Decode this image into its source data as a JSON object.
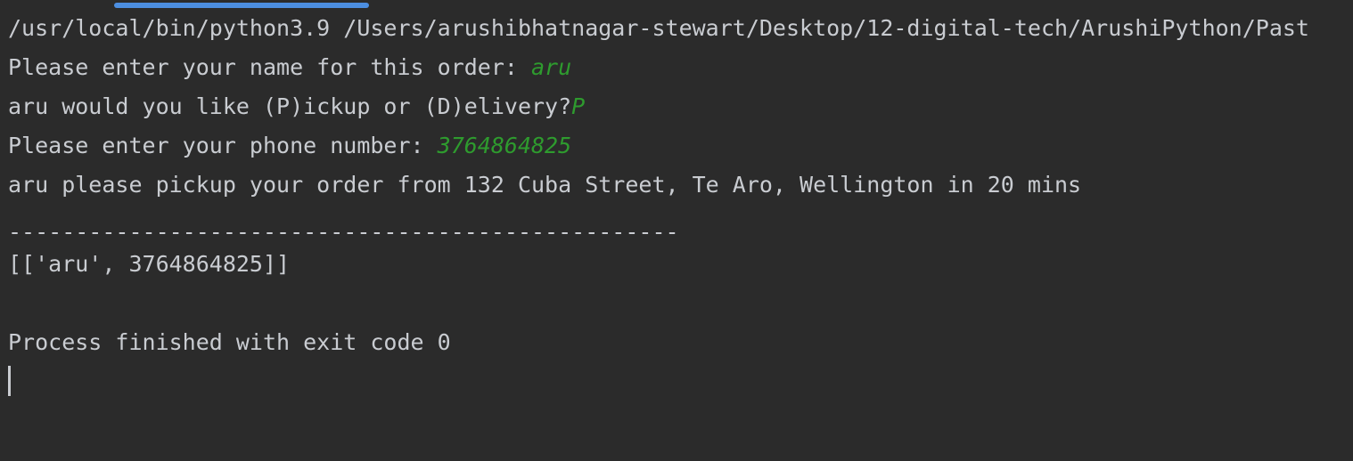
{
  "console": {
    "command": "/usr/local/bin/python3.9 /Users/arushibhatnagar-stewart/Desktop/12-digital-tech/ArushiPython/Past",
    "name_prompt": "Please enter your name for this order: ",
    "name_input": "aru",
    "method_prompt": "aru would you like (P)ickup or (D)elivery?",
    "method_input": "P",
    "phone_prompt": "Please enter your phone number: ",
    "phone_input": "3764864825",
    "pickup_message": "aru please pickup your order from 132 Cuba Street, Te Aro, Wellington in 20 mins",
    "separator": "--------------------------------------------------",
    "list_output": "[['aru', 3764864825]]",
    "exit_message": "Process finished with exit code 0"
  },
  "colors": {
    "background": "#2b2b2b",
    "text": "#c9ccd1",
    "user_input": "#2e9b2e",
    "scroll_thumb": "#4c8ee0"
  }
}
